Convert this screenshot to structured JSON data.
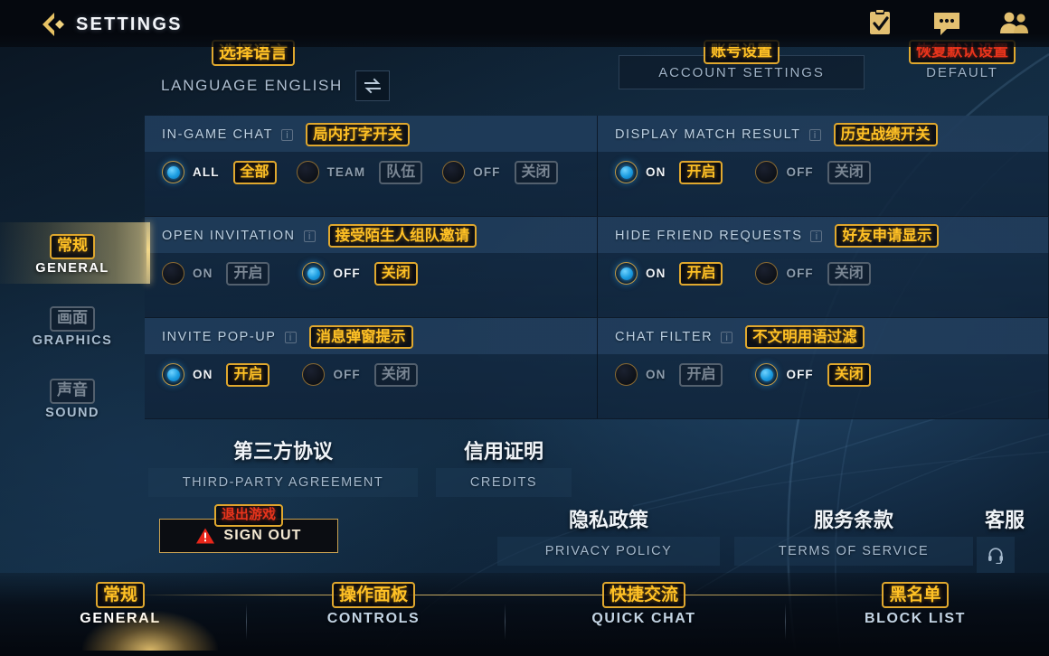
{
  "topbar": {
    "title": "SETTINGS",
    "back_icon": "back-chevron-icon",
    "icons": [
      {
        "name": "clipboard-check-icon"
      },
      {
        "name": "chat-bubble-icon"
      },
      {
        "name": "friends-icon"
      }
    ]
  },
  "header": {
    "language": {
      "cn": "选择语言",
      "en": "LANGUAGE ENGLISH",
      "swap_icon": "swap-arrows-icon"
    },
    "account_settings": {
      "cn": "账号设置",
      "en": "ACCOUNT SETTINGS"
    },
    "default": {
      "cn": "恢复默认设置",
      "en": "DEFAULT"
    }
  },
  "settings": [
    {
      "label": "IN-GAME CHAT",
      "cn": "局内打字开关",
      "info": "i",
      "options": [
        {
          "en": "ALL",
          "cn": "全部",
          "selected": true
        },
        {
          "en": "TEAM",
          "cn": "队伍",
          "selected": false
        },
        {
          "en": "OFF",
          "cn": "关闭",
          "selected": false
        }
      ]
    },
    {
      "label": "DISPLAY MATCH RESULT",
      "cn": "历史战绩开关",
      "info": "i",
      "options": [
        {
          "en": "ON",
          "cn": "开启",
          "selected": true
        },
        {
          "en": "OFF",
          "cn": "关闭",
          "selected": false
        }
      ]
    },
    {
      "label": "OPEN INVITATION",
      "cn": "接受陌生人组队邀请",
      "info": "i",
      "options": [
        {
          "en": "ON",
          "cn": "开启",
          "selected": false
        },
        {
          "en": "OFF",
          "cn": "关闭",
          "selected": true
        }
      ]
    },
    {
      "label": "HIDE FRIEND REQUESTS",
      "cn": "好友申请显示",
      "info": "i",
      "options": [
        {
          "en": "ON",
          "cn": "开启",
          "selected": true
        },
        {
          "en": "OFF",
          "cn": "关闭",
          "selected": false
        }
      ]
    },
    {
      "label": "INVITE POP-UP",
      "cn": "消息弹窗提示",
      "info": "i",
      "options": [
        {
          "en": "ON",
          "cn": "开启",
          "selected": true
        },
        {
          "en": "OFF",
          "cn": "关闭",
          "selected": false
        }
      ]
    },
    {
      "label": "CHAT FILTER",
      "cn": "不文明用语过滤",
      "info": "i",
      "options": [
        {
          "en": "ON",
          "cn": "开启",
          "selected": false
        },
        {
          "en": "OFF",
          "cn": "关闭",
          "selected": true
        }
      ]
    }
  ],
  "sidebar": [
    {
      "cn": "常规",
      "en": "GENERAL",
      "active": true
    },
    {
      "cn": "画面",
      "en": "GRAPHICS",
      "active": false
    },
    {
      "cn": "声音",
      "en": "SOUND",
      "active": false
    }
  ],
  "links": {
    "third_party": {
      "cn": "第三方协议",
      "en": "THIRD-PARTY AGREEMENT"
    },
    "credits": {
      "cn": "信用证明",
      "en": "CREDITS"
    },
    "privacy": {
      "cn": "隐私政策",
      "en": "PRIVACY POLICY"
    },
    "terms": {
      "cn": "服务条款",
      "en": "TERMS OF SERVICE"
    },
    "support": {
      "cn": "客服",
      "icon": "headset-icon"
    },
    "sign_out": {
      "cn": "退出游戏",
      "en": "SIGN OUT",
      "icon": "warning-triangle-icon"
    }
  },
  "tabs": [
    {
      "cn": "常规",
      "en": "GENERAL",
      "active": true
    },
    {
      "cn": "操作面板",
      "en": "CONTROLS",
      "active": false
    },
    {
      "cn": "快捷交流",
      "en": "QUICK CHAT",
      "active": false
    },
    {
      "cn": "黑名单",
      "en": "BLOCK LIST",
      "active": false
    }
  ],
  "colors": {
    "gold": "#ffc125",
    "gold_border": "#e0a82e",
    "red": "#e8341c",
    "cyan": "#1b9ce0",
    "dim": "#7b8794"
  }
}
